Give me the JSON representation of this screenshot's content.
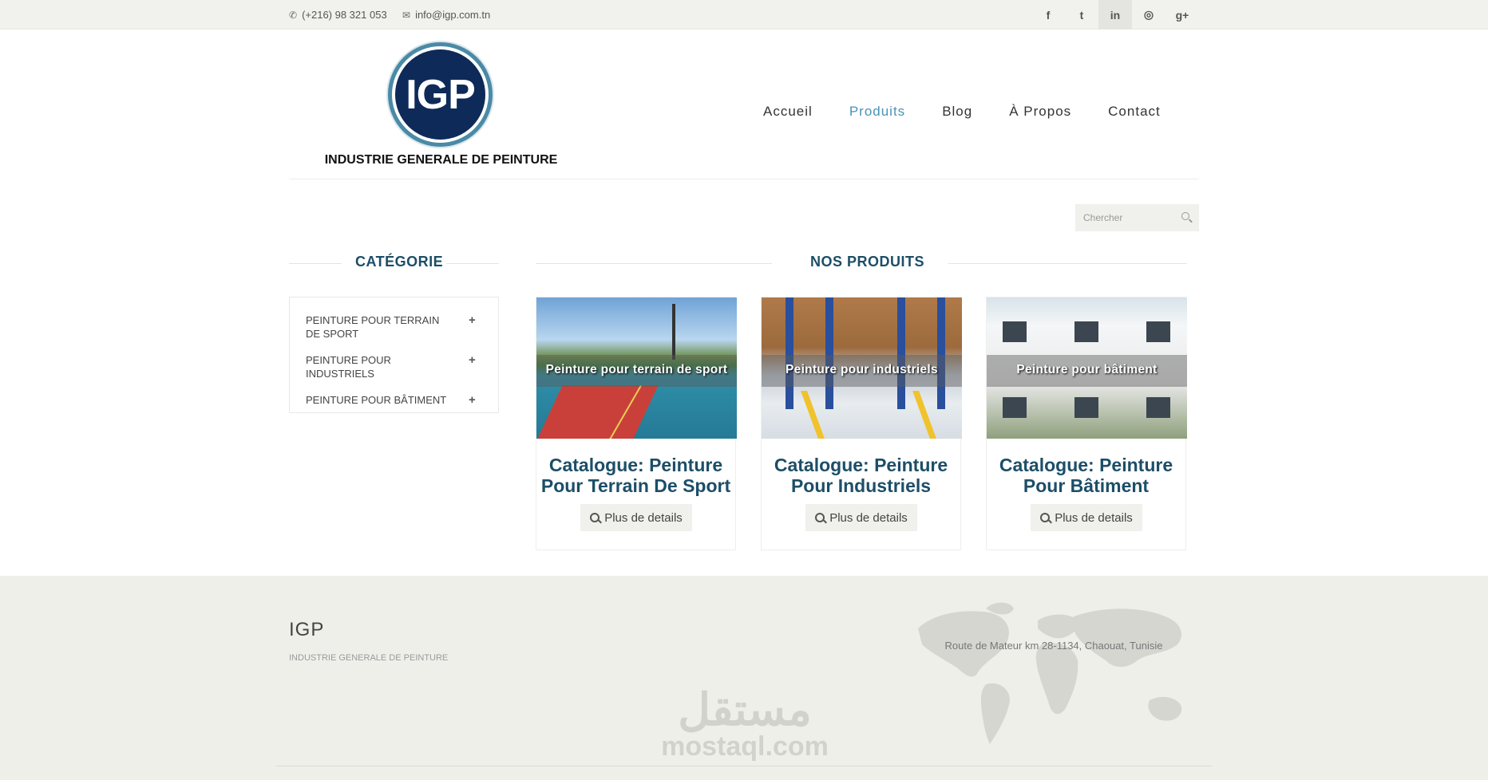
{
  "topbar": {
    "phone": "(+216) 98 321 053",
    "email": "info@igp.com.tn",
    "social": [
      "f",
      "t",
      "in",
      "◎",
      "g+"
    ]
  },
  "logo": {
    "text": "IGP",
    "subtitle": "INDUSTRIE GENERALE DE PEINTURE"
  },
  "nav": {
    "items": [
      "Accueil",
      "Produits",
      "Blog",
      "À Propos",
      "Contact"
    ],
    "active": "Produits"
  },
  "search": {
    "placeholder": "Chercher"
  },
  "sidebar": {
    "title": "CATÉGORIE",
    "items": [
      {
        "label": "PEINTURE POUR TERRAIN DE SPORT"
      },
      {
        "label": "PEINTURE POUR INDUSTRIELS"
      },
      {
        "label": "PEINTURE POUR BÂTIMENT"
      }
    ]
  },
  "products": {
    "title": "NOS PRODUITS",
    "items": [
      {
        "caption": "Peinture pour terrain de sport",
        "title": "Catalogue: Peinture Pour Terrain De Sport",
        "button": "Plus de details"
      },
      {
        "caption": "Peinture pour industriels",
        "title": "Catalogue: Peinture Pour Industriels",
        "button": "Plus de details"
      },
      {
        "caption": "Peinture pour bâtiment",
        "title": "Catalogue: Peinture Pour Bâtiment",
        "button": "Plus de details"
      }
    ]
  },
  "footer": {
    "brand": "IGP",
    "subtitle": "INDUSTRIE GENERALE DE PEINTURE",
    "address": "Route de Mateur km 28-1134, Chaouat, Tunisie",
    "watermark_ar": "مستقل",
    "watermark_lat": "mostaql.com"
  },
  "colors": {
    "accent": "#4a93b4",
    "heading": "#1c4e68",
    "topbar_bg": "#f1f1ee",
    "footer_bg": "#efefea"
  }
}
